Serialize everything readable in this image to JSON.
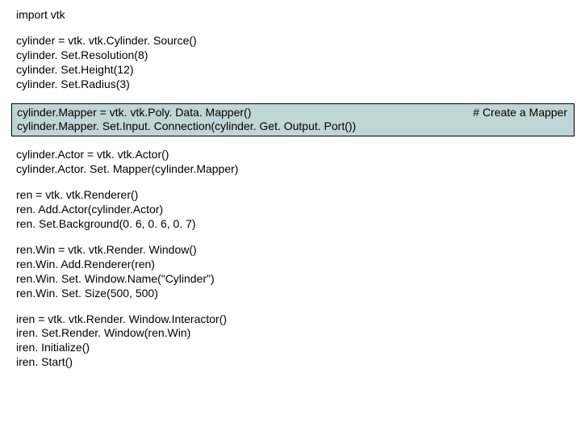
{
  "code": {
    "import_line": "import vtk",
    "cylinder_block": [
      "cylinder = vtk. vtk.Cylinder. Source()",
      "cylinder. Set.Resolution(8)",
      "cylinder. Set.Height(12)",
      "cylinder. Set.Radius(3)"
    ],
    "mapper_block": {
      "lines": [
        "cylinder.Mapper = vtk. vtk.Poly. Data. Mapper()",
        "cylinder.Mapper. Set.Input. Connection(cylinder. Get. Output. Port())"
      ],
      "comment": "# Create a Mapper"
    },
    "actor_block": [
      "cylinder.Actor = vtk. vtk.Actor()",
      "cylinder.Actor. Set. Mapper(cylinder.Mapper)"
    ],
    "renderer_block": [
      "ren = vtk. vtk.Renderer()",
      "ren. Add.Actor(cylinder.Actor)",
      "ren. Set.Background(0. 6, 0. 6, 0. 7)"
    ],
    "renwin_block": [
      "ren.Win = vtk. vtk.Render. Window()",
      "ren.Win. Add.Renderer(ren)",
      "ren.Win. Set. Window.Name(\"Cylinder\")",
      "ren.Win. Set. Size(500, 500)"
    ],
    "iren_block": [
      "iren = vtk. vtk.Render. Window.Interactor()",
      "iren. Set.Render. Window(ren.Win)",
      "iren. Initialize()",
      "iren. Start()"
    ]
  }
}
